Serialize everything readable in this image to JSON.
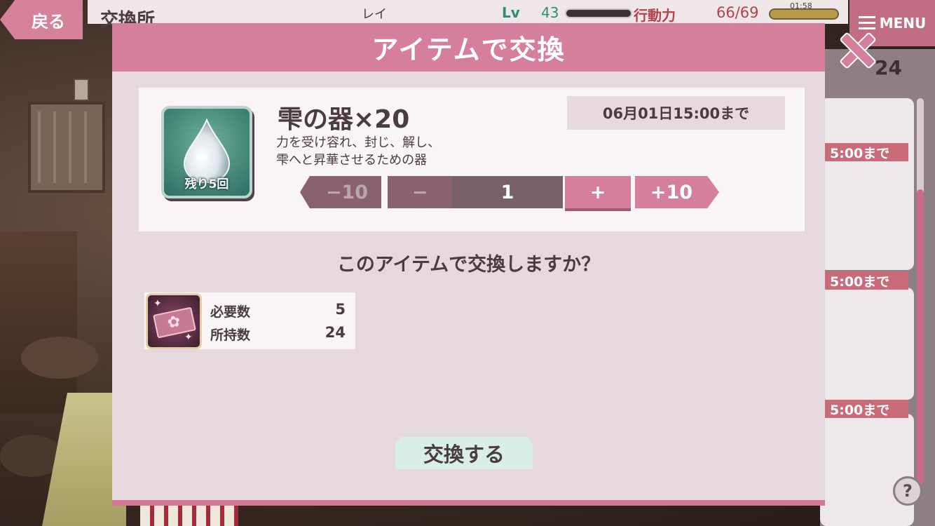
{
  "hud": {
    "back_label": "戻る",
    "page_title": "交換所",
    "player_name": "レイ",
    "lv_label": "Lv",
    "lv_value": "43",
    "ap_label": "行動力",
    "ap_value": "66/69",
    "ap_timer": "01:58",
    "menu_label": "MENU"
  },
  "side": {
    "owned_count": "24",
    "badges": [
      "5:00まで",
      "5:00まで",
      "5:00まで"
    ]
  },
  "dialog": {
    "title": "アイテムで交換",
    "item": {
      "name": "雫の器×20",
      "deadline": "06月01日15:00まで",
      "desc_line1": "力を受け容れ、封じ、解し、",
      "desc_line2": "雫へと昇華させるための器",
      "remaining": "残り5回",
      "icon": "water-drop-icon"
    },
    "quantity": {
      "minus10": "−10",
      "minus1": "−",
      "value": "1",
      "plus1": "+",
      "plus10": "+10"
    },
    "question": "このアイテムで交換しますか？",
    "cost": {
      "icon": "sakura-ticket-icon",
      "required_label": "必要数",
      "required_value": "5",
      "owned_label": "所持数",
      "owned_value": "24"
    },
    "exchange_label": "交換する"
  },
  "colors": {
    "accent_pink": "#d57f9b",
    "dialog_bg": "#e5d9df",
    "text_dark": "#4a3c42",
    "lv_green": "#2f8c76",
    "ap_red": "#b2434e"
  }
}
